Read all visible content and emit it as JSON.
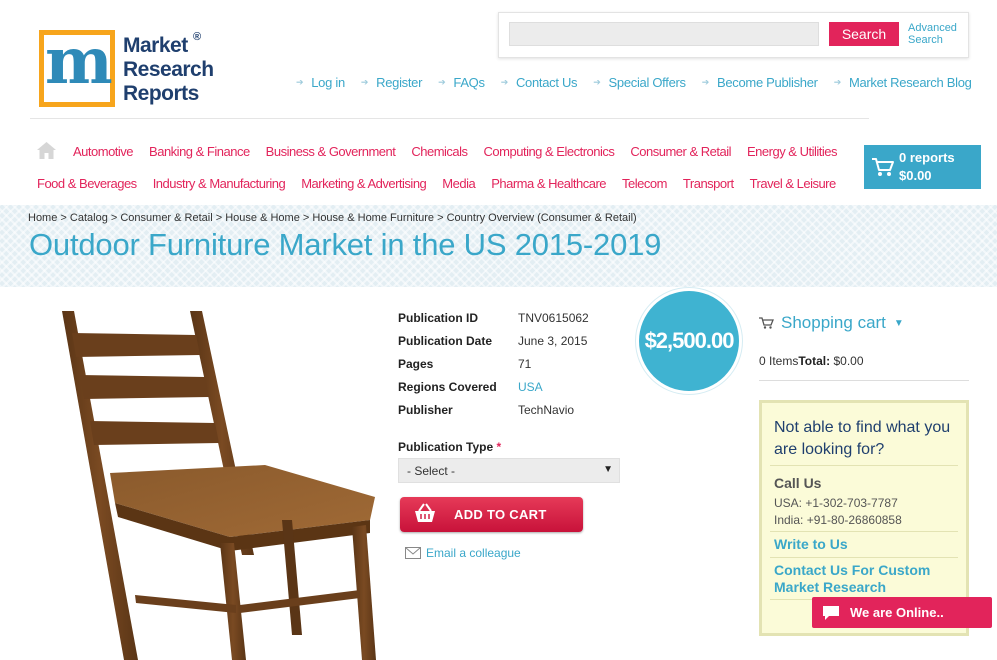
{
  "logo": {
    "line1": "Market",
    "line2": "Research",
    "line3": "Reports",
    "reg": "®"
  },
  "search": {
    "placeholder": "",
    "button_label": "Search",
    "advanced_label": "Advanced Search"
  },
  "top_links": [
    "Log in",
    "Register",
    "FAQs",
    "Contact Us",
    "Special Offers",
    "Become Publisher",
    "Market Research Blog"
  ],
  "categories_row1": [
    "Automotive",
    "Banking & Finance",
    "Business & Government",
    "Chemicals",
    "Computing & Electronics",
    "Consumer & Retail",
    "Energy & Utilities"
  ],
  "categories_row2": [
    "Food & Beverages",
    "Industry & Manufacturing",
    "Marketing & Advertising",
    "Media",
    "Pharma & Healthcare",
    "Telecom",
    "Transport",
    "Travel & Leisure"
  ],
  "cart": {
    "reports": "0 reports",
    "total": "$0.00"
  },
  "breadcrumb": [
    "Home",
    "Catalog",
    "Consumer & Retail",
    "House & Home",
    "House & Home Furniture",
    "Country Overview (Consumer & Retail)"
  ],
  "page_title": "Outdoor Furniture Market in the US 2015-2019",
  "details": [
    {
      "label": "Publication ID",
      "value": "TNV0615062",
      "link": false
    },
    {
      "label": "Publication Date",
      "value": "June 3, 2015",
      "link": false
    },
    {
      "label": "Pages",
      "value": "71",
      "link": false
    },
    {
      "label": "Regions Covered",
      "value": "USA",
      "link": true
    },
    {
      "label": "Publisher",
      "value": "TechNavio",
      "link": false
    }
  ],
  "price": "$2,500.00",
  "publication_type": {
    "label": "Publication Type",
    "required": "*",
    "selected": "- Select -"
  },
  "add_to_cart_label": "ADD TO CART",
  "email_colleague_label": "Email a colleague",
  "shopping_cart": {
    "title": "Shopping cart",
    "items": "0 Items",
    "total_label": "Total:",
    "total_value": "$0.00"
  },
  "help": {
    "question": "Not able to find what you are looking for?",
    "call_title": "Call Us",
    "usa_phone": "USA: +1-302-703-7787",
    "india_phone": "India: +91-80-26860858",
    "write_label": "Write to Us",
    "custom_label": "Contact Us For Custom Market Research"
  },
  "chat_label": "We are Online..",
  "colors": {
    "accent_blue": "#3aa7c9",
    "accent_pink": "#e2245b",
    "logo_orange": "#f7a51c"
  }
}
